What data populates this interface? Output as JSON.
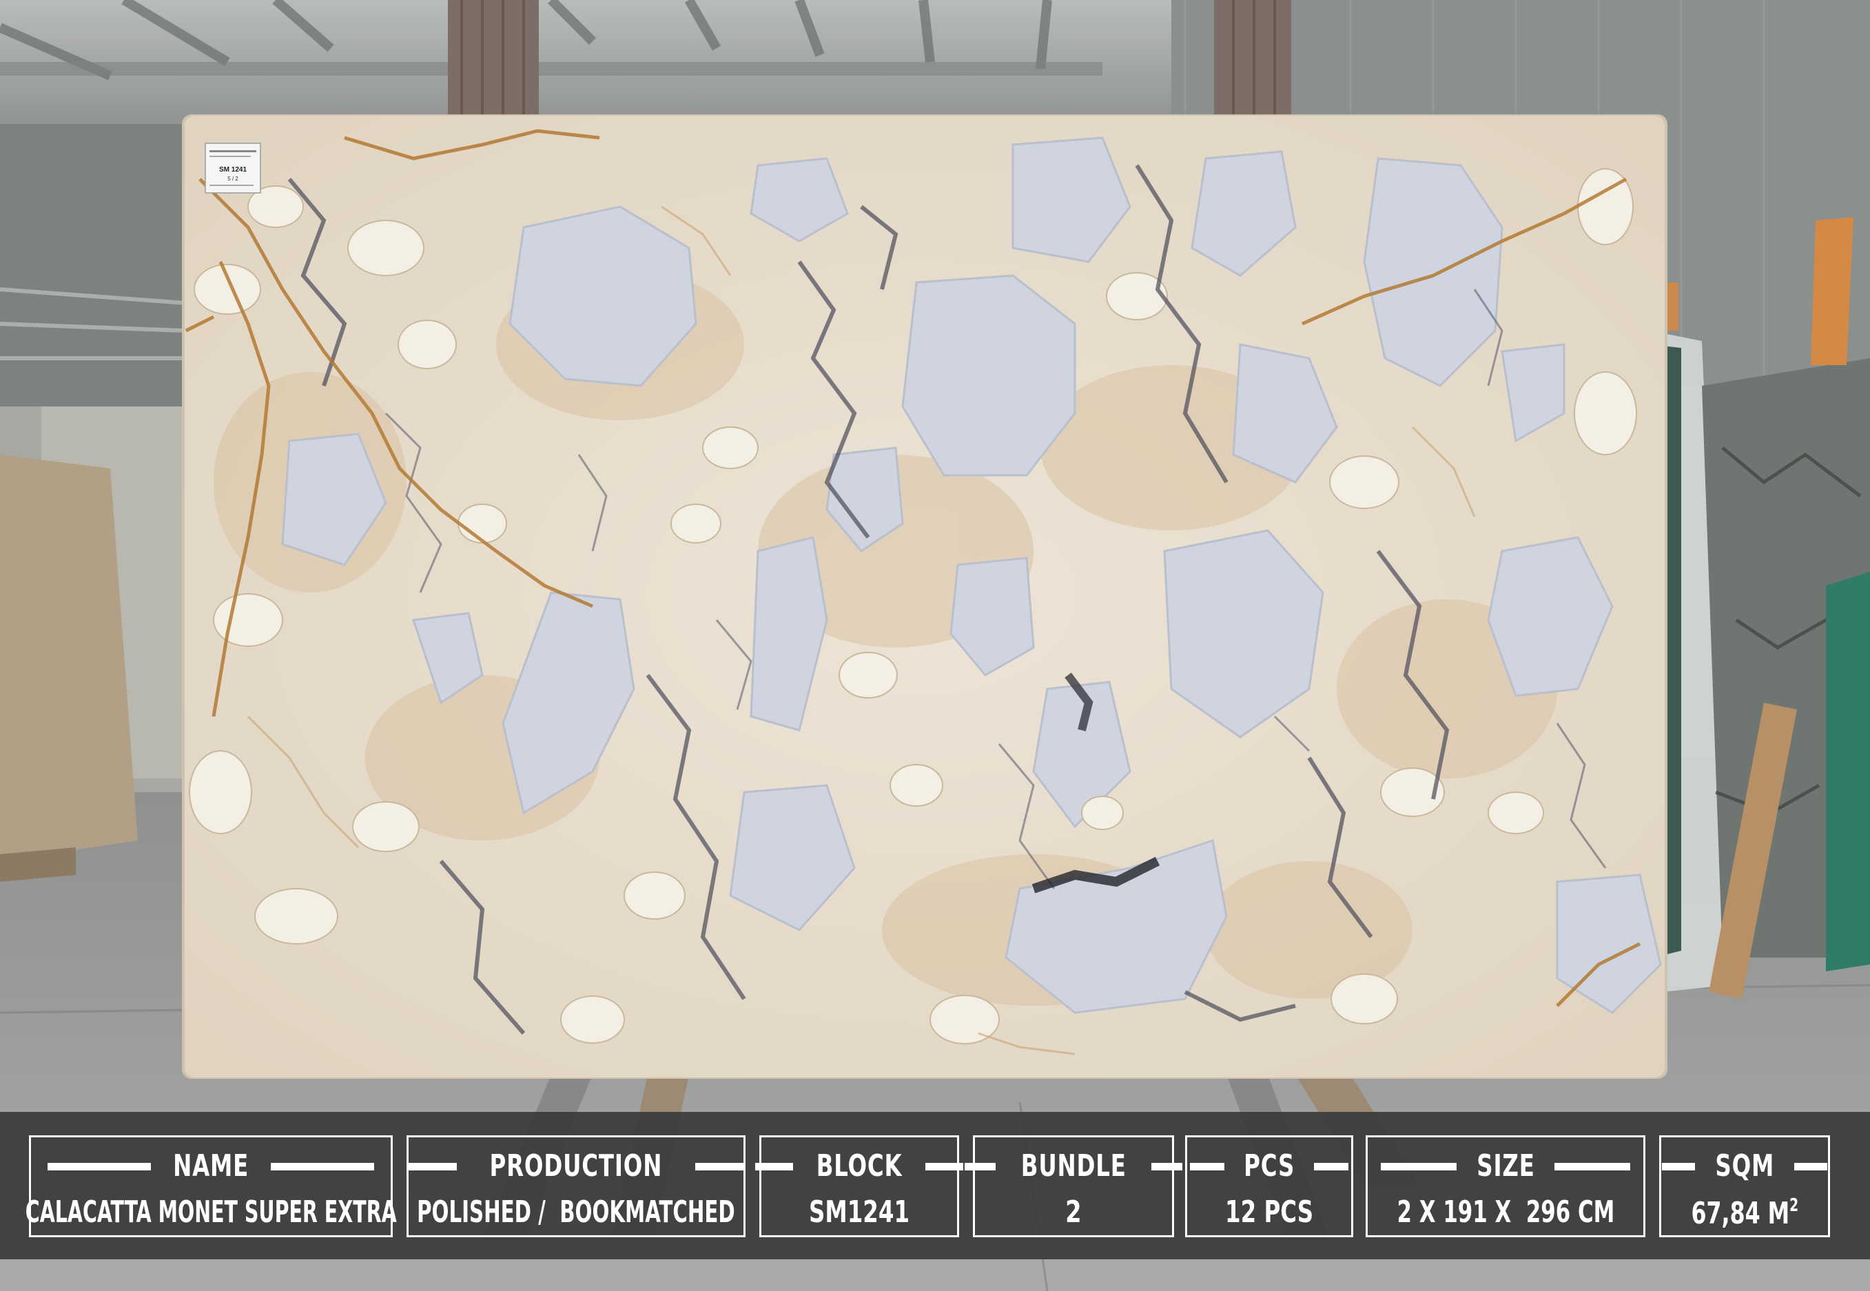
{
  "photo": {
    "subject": "polished marble slab on display rack in warehouse",
    "tag_text": "SM 1241",
    "tag_subtext": "5 / 2"
  },
  "info_bar": {
    "colors": {
      "background": "#3a3a3a",
      "border": "#ffffff",
      "text": "#ffffff"
    },
    "fields": [
      {
        "label": "NAME",
        "value": "CALACATTA MONET SUPER EXTRA"
      },
      {
        "label": "PRODUCTION",
        "value": "POLISHED /  BOOKMATCHED"
      },
      {
        "label": "BLOCK",
        "value": "SM1241"
      },
      {
        "label": "BUNDLE",
        "value": "2"
      },
      {
        "label": "PCS",
        "value": "12 PCS"
      },
      {
        "label": "SIZE",
        "value": "2 X 191 X  296 CM"
      },
      {
        "label": "SQM",
        "value": "67,84 M",
        "unit_superscript": "2"
      }
    ]
  }
}
